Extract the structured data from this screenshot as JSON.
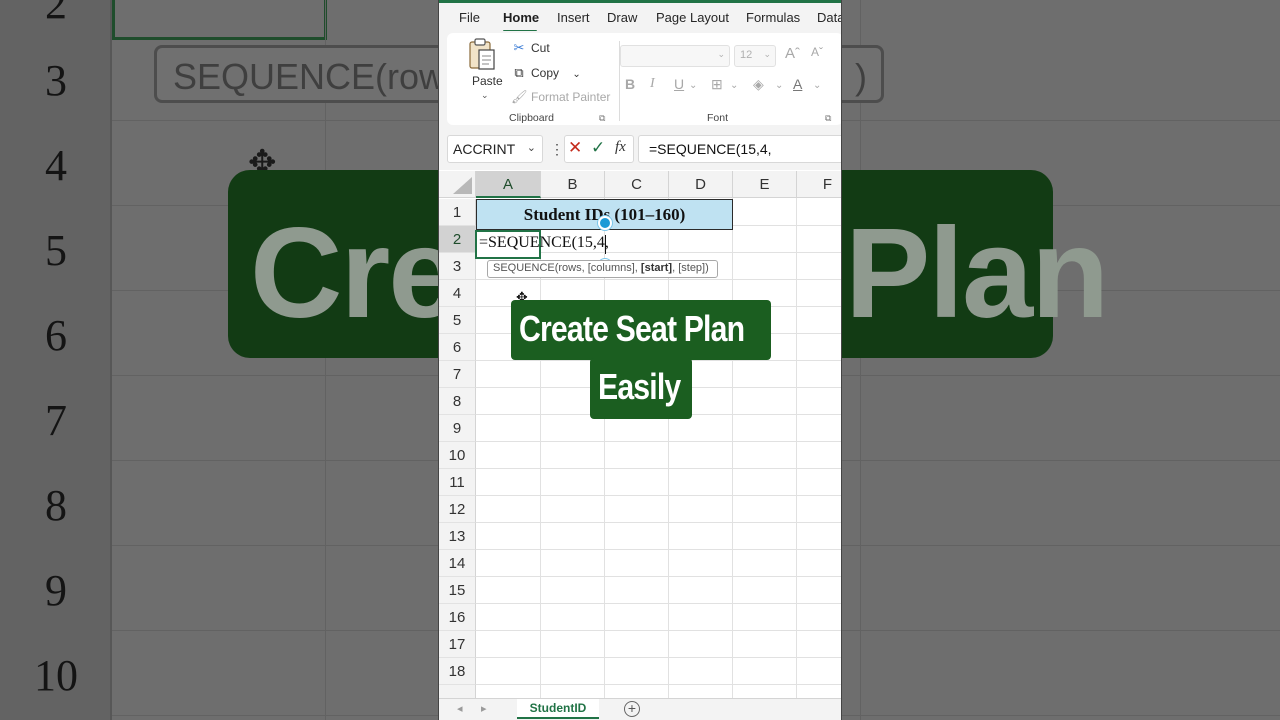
{
  "menu": {
    "items": [
      "File",
      "Home",
      "Insert",
      "Draw",
      "Page Layout",
      "Formulas",
      "Data"
    ],
    "active": "Home"
  },
  "ribbon": {
    "clipboard": {
      "paste_label": "Paste",
      "cut_label": "Cut",
      "copy_label": "Copy",
      "format_painter_label": "Format Painter",
      "group_label": "Clipboard"
    },
    "font": {
      "font_name": "",
      "font_size": "12",
      "group_label": "Font",
      "bold": "B",
      "italic": "I",
      "underline": "U",
      "grow": "Aˆ",
      "shrink": "Aˇ"
    }
  },
  "formula_bar": {
    "name_box": "ACCRINT",
    "fx_label": "fx",
    "formula": "=SEQUENCE(15,4,"
  },
  "grid": {
    "columns": [
      "A",
      "B",
      "C",
      "D",
      "E",
      "F"
    ],
    "selected_column": "A",
    "rows": [
      "1",
      "2",
      "3",
      "4",
      "5",
      "6",
      "7",
      "8",
      "9",
      "10",
      "11",
      "12",
      "13",
      "14",
      "15",
      "16",
      "17",
      "18"
    ],
    "selected_row": "2",
    "header_cell_text": "Student IDs (101–160)",
    "active_cell_text": "=SEQUENCE(15,4,",
    "tooltip": {
      "prefix": "SEQUENCE(rows, [columns], ",
      "current_arg": "[start]",
      "suffix": ", [step])"
    }
  },
  "overlay": {
    "line1": "Create Seat Plan",
    "line2": "Easily",
    "color": "#1b5e20"
  },
  "sheet_tabs": {
    "active_tab": "StudentID",
    "add_label": "+"
  },
  "background": {
    "row_numbers": [
      "2",
      "3",
      "4",
      "5",
      "6",
      "7",
      "8",
      "9",
      "10"
    ],
    "tooltip_text": "SEQUENCE(rows",
    "tooltip_text_right": ")",
    "banner_left": "Crea",
    "banner_right": "Plan"
  },
  "colors": {
    "excel_green": "#217346",
    "header_fill": "#bfe2f2",
    "selection_handle": "#1c9ad6"
  }
}
